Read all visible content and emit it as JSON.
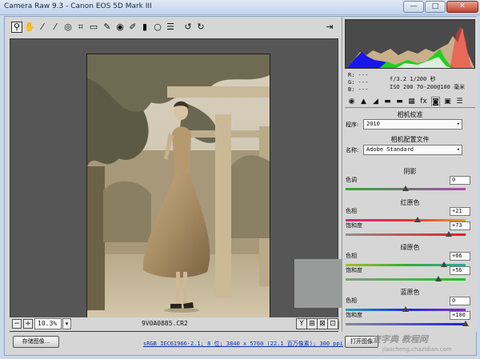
{
  "window": {
    "title": "Camera Raw 9.3 -  Canon EOS 5D Mark III",
    "minimize": "—",
    "maximize": "□",
    "close": "✕"
  },
  "toolbar": {
    "tools": [
      {
        "name": "zoom-tool-icon",
        "glyph": "⚲"
      },
      {
        "name": "hand-tool-icon",
        "glyph": "✋"
      },
      {
        "name": "white-balance-tool-icon",
        "glyph": "⁄"
      },
      {
        "name": "color-sampler-tool-icon",
        "glyph": "⁄"
      },
      {
        "name": "targeted-adjust-tool-icon",
        "glyph": "◎"
      },
      {
        "name": "crop-tool-icon",
        "glyph": "⌗"
      },
      {
        "name": "straighten-tool-icon",
        "glyph": "▭"
      },
      {
        "name": "spot-removal-tool-icon",
        "glyph": "✎"
      },
      {
        "name": "red-eye-tool-icon",
        "glyph": "◉"
      },
      {
        "name": "adjustment-brush-icon",
        "glyph": "✐"
      },
      {
        "name": "graduated-filter-icon",
        "glyph": "▮"
      },
      {
        "name": "radial-filter-icon",
        "glyph": "○"
      },
      {
        "name": "preferences-icon",
        "glyph": "☰"
      },
      {
        "name": "rotate-left-icon",
        "glyph": "↺"
      },
      {
        "name": "rotate-right-icon",
        "glyph": "↻"
      }
    ],
    "fullscreen_glyph": "⇥"
  },
  "preview": {
    "warning_badge": "!"
  },
  "statusbar": {
    "zoom_out": "−",
    "zoom_in": "+",
    "zoom_value": "10.3%",
    "zoom_arrow": "▾",
    "filename": "9V0A0885.CR2",
    "view_buttons": [
      "Y",
      "⊞",
      "⊠",
      "⊡"
    ]
  },
  "histogram": {
    "colors": {
      "red": "#ff3030",
      "green": "#20d020",
      "blue": "#1818e8",
      "tan": "#c9b08a",
      "white": "#f0f0f0"
    }
  },
  "camera_info": {
    "r": "R:   ---",
    "g": "G:   ---",
    "b": "B:   ---",
    "aperture_shutter": "f/3.2   1/200 秒",
    "iso_lens": "ISO 200   70-200@100 毫米"
  },
  "tabs": [
    "◉",
    "▲",
    "◢",
    "▬",
    "▬",
    "▦",
    "fx",
    "◙",
    "▣",
    "☰"
  ],
  "camera_calibration": {
    "title": "相机校准",
    "process_label": "程序:",
    "process_value": "2010",
    "profile_section": "相机配置文件",
    "name_label": "名称:",
    "name_value": "Adobe Standard"
  },
  "shadows": {
    "title": "阴影",
    "tint_label": "色调",
    "tint_value": "0",
    "tint_position": 0.5
  },
  "red_primary": {
    "title": "红原色",
    "hue_label": "色相",
    "hue_value": "+21",
    "hue_position": 0.6,
    "sat_label": "饱和度",
    "sat_value": "+73",
    "sat_position": 0.86
  },
  "green_primary": {
    "title": "绿原色",
    "hue_label": "色相",
    "hue_value": "+66",
    "hue_position": 0.82,
    "sat_label": "饱和度",
    "sat_value": "+56",
    "sat_position": 0.77
  },
  "blue_primary": {
    "title": "蓝原色",
    "hue_label": "色相",
    "hue_value": "0",
    "hue_position": 0.5,
    "sat_label": "饱和度",
    "sat_value": "+100",
    "sat_position": 1.0
  },
  "bottom": {
    "save_button": "存储图像...",
    "workflow_link": "sRGB IEC61966-2.1; 8 位; 3840 x 5760 (22.1 百万像素); 300 ppi",
    "open_button": "打开图像"
  },
  "watermark": {
    "line1": "查字典 教程网",
    "line2": "jiaocheng.chazidian.com"
  }
}
